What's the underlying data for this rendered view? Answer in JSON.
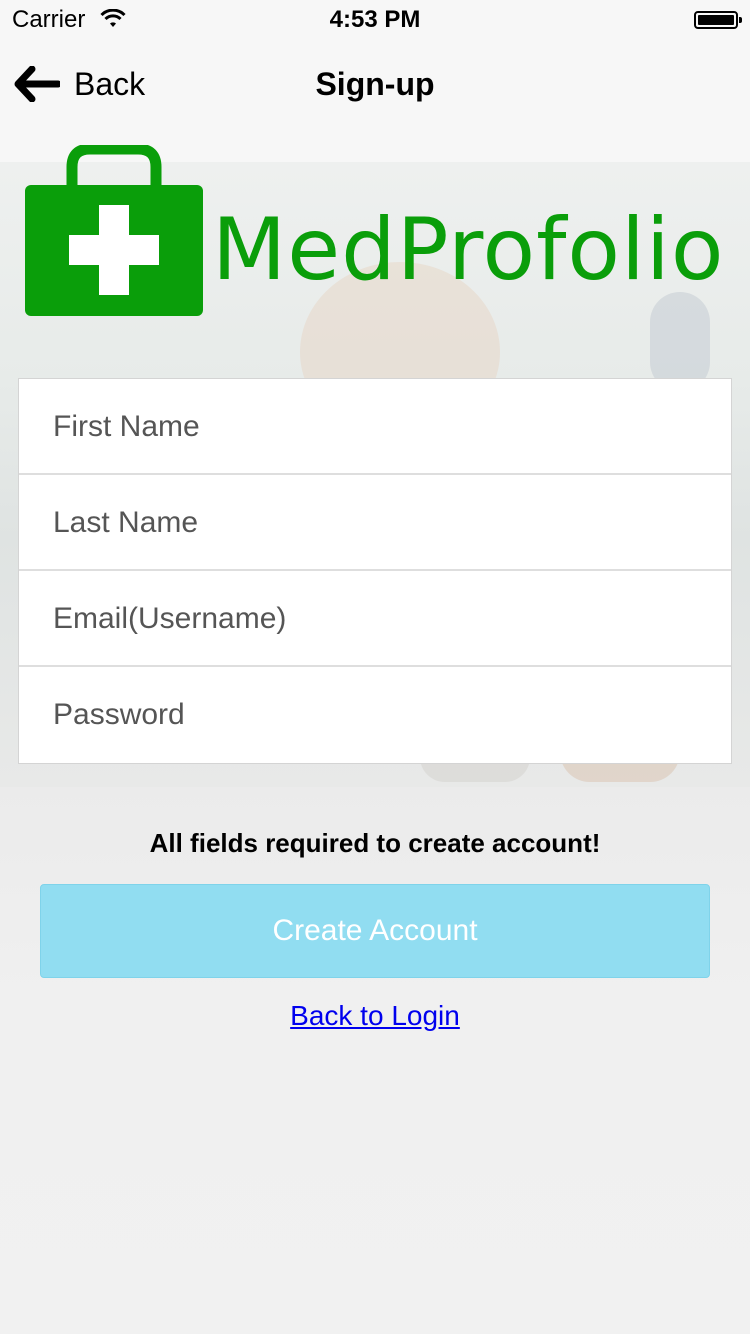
{
  "status_bar": {
    "carrier": "Carrier",
    "time": "4:53 PM"
  },
  "nav": {
    "back_label": "Back",
    "title": "Sign-up"
  },
  "logo": {
    "wordmark": "MedProfolio",
    "brand_color": "#0a9e0a"
  },
  "form": {
    "fields": [
      {
        "name": "first-name",
        "placeholder": "First Name",
        "value": ""
      },
      {
        "name": "last-name",
        "placeholder": "Last Name",
        "value": ""
      },
      {
        "name": "email",
        "placeholder": "Email(Username)",
        "value": ""
      },
      {
        "name": "password",
        "placeholder": "Password",
        "value": ""
      }
    ]
  },
  "required_note": "All fields required to create account!",
  "create_button": {
    "label": "Create Account",
    "color": "#91ddf1"
  },
  "back_to_login": "Back to Login",
  "icons": {
    "back": "arrow-left-icon",
    "wifi": "wifi-icon",
    "battery": "battery-icon",
    "medical_bag": "medical-bag-icon"
  }
}
